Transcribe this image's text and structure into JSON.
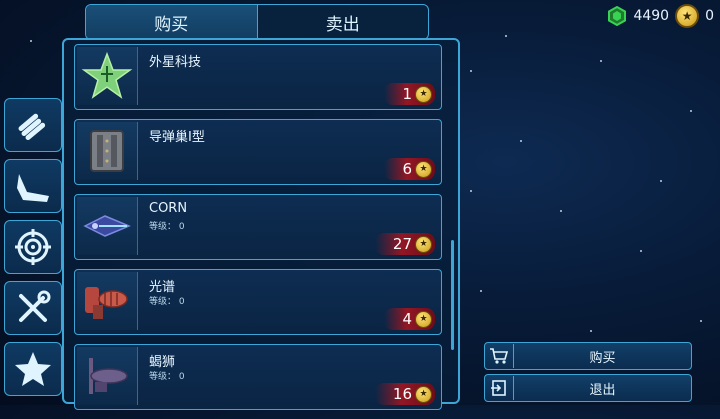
{
  "tabs": {
    "buy": "购买",
    "sell": "卖出",
    "active": "buy"
  },
  "currency": {
    "gems": "4490",
    "stars": "0",
    "gem_icon": "green-crystal-icon",
    "star_icon": "star-coin-icon"
  },
  "categories": [
    {
      "icon": "missile-rack-icon"
    },
    {
      "icon": "fighter-wing-icon"
    },
    {
      "icon": "crosshair-icon"
    },
    {
      "icon": "tools-icon"
    },
    {
      "icon": "star-icon"
    }
  ],
  "items": [
    {
      "name": "外星科技",
      "level_label": "",
      "level": "",
      "price": "1",
      "icon": "alien-tech-star-icon"
    },
    {
      "name": "导弹巢I型",
      "level_label": "",
      "level": "",
      "price": "6",
      "icon": "missile-nest-icon"
    },
    {
      "name": "CORN",
      "level_label": "等级：",
      "level": "0",
      "price": "27",
      "icon": "corn-ship-icon"
    },
    {
      "name": "光谱",
      "level_label": "等级：",
      "level": "0",
      "price": "4",
      "icon": "spectrum-ship-icon"
    },
    {
      "name": "蝎狮",
      "level_label": "等级：",
      "level": "0",
      "price": "16",
      "icon": "manticore-ship-icon"
    }
  ],
  "actions": {
    "buy": "购买",
    "exit": "退出"
  },
  "colors": {
    "accent": "#3ea6d6",
    "gem": "#39d353",
    "coin": "#f2c230",
    "price_bg": "#b0141e"
  }
}
